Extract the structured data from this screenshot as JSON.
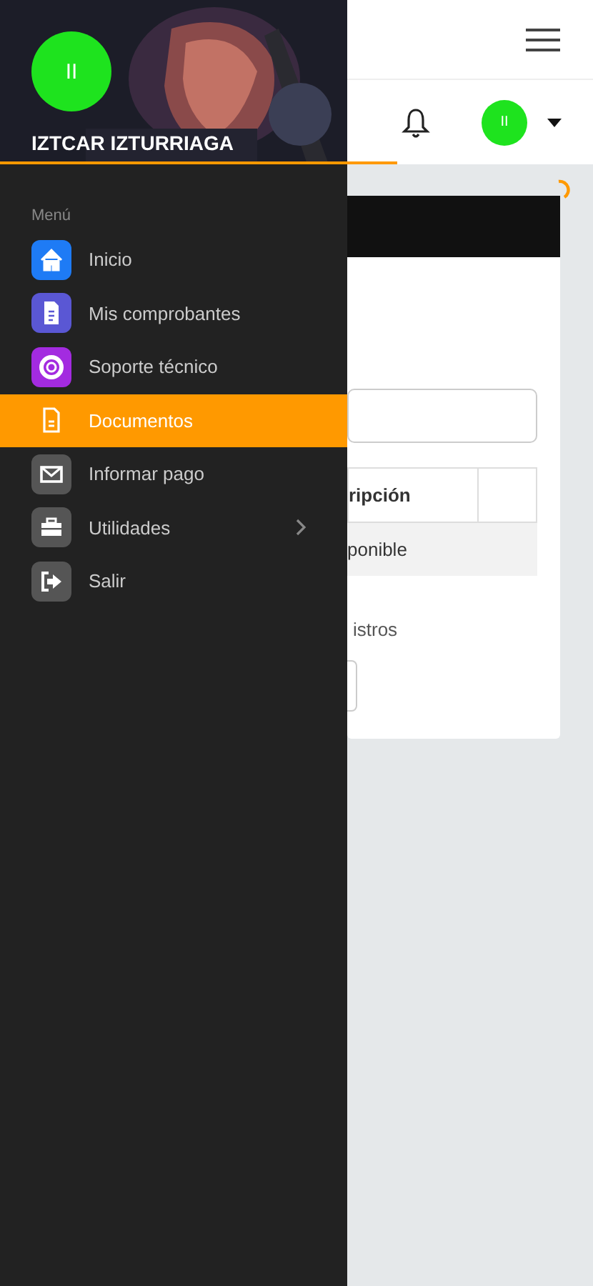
{
  "page": {
    "user_initials": "II",
    "loading": true,
    "table": {
      "columns": [
        "ripción"
      ],
      "rows": [
        [
          "ponible"
        ]
      ]
    },
    "footer_text": "istros"
  },
  "drawer": {
    "user": {
      "initials": "II",
      "name": "IZTCAR IZTURRIAGA"
    },
    "menu_label": "Menú",
    "items": [
      {
        "label": "Inicio",
        "color": "#1e7bf5",
        "selected": false,
        "submenu": false
      },
      {
        "label": "Mis comprobantes",
        "color": "#5a57d4",
        "selected": false,
        "submenu": false
      },
      {
        "label": "Soporte técnico",
        "color": "#a32be0",
        "selected": false,
        "submenu": false
      },
      {
        "label": "Documentos",
        "selected": true,
        "submenu": false
      },
      {
        "label": "Informar pago",
        "color": "#555555",
        "selected": false,
        "submenu": false
      },
      {
        "label": "Utilidades",
        "color": "#555555",
        "selected": false,
        "submenu": true
      },
      {
        "label": "Salir",
        "color": "#555555",
        "selected": false,
        "submenu": false
      }
    ]
  }
}
